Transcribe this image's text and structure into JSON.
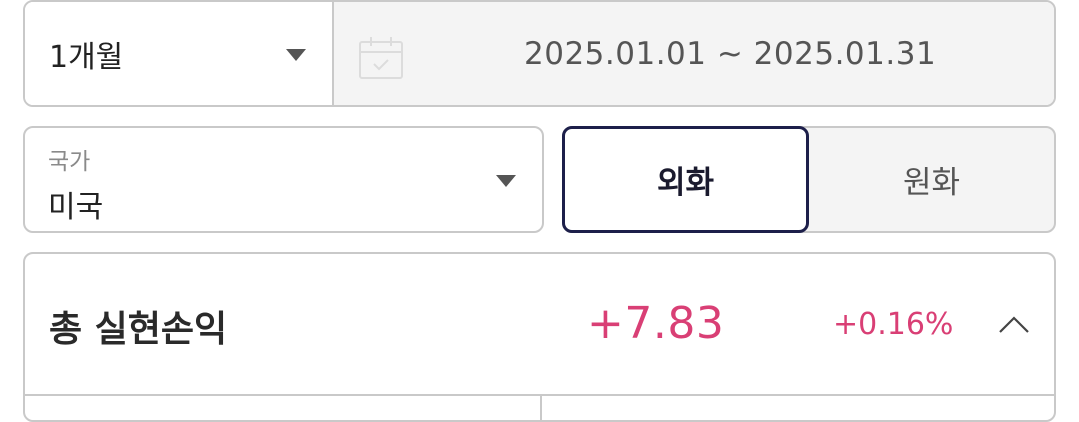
{
  "period": {
    "selected": "1개월",
    "icon": "chevron-down-icon"
  },
  "date_range": {
    "icon": "calendar-icon",
    "text": "2025.01.01 ~ 2025.01.31"
  },
  "country": {
    "label": "국가",
    "selected": "미국",
    "icon": "chevron-down-icon"
  },
  "currency_toggle": {
    "foreign_label": "외화",
    "won_label": "원화",
    "active": "외화"
  },
  "summary": {
    "title": "총 실현손익",
    "amount": "+7.83",
    "rate": "+0.16%",
    "icon": "chevron-up-icon"
  },
  "colors": {
    "positive": "#d93f75",
    "active_border": "#1d1f4a",
    "border": "#c9c9c9",
    "disabled_bg": "#f4f4f4"
  }
}
